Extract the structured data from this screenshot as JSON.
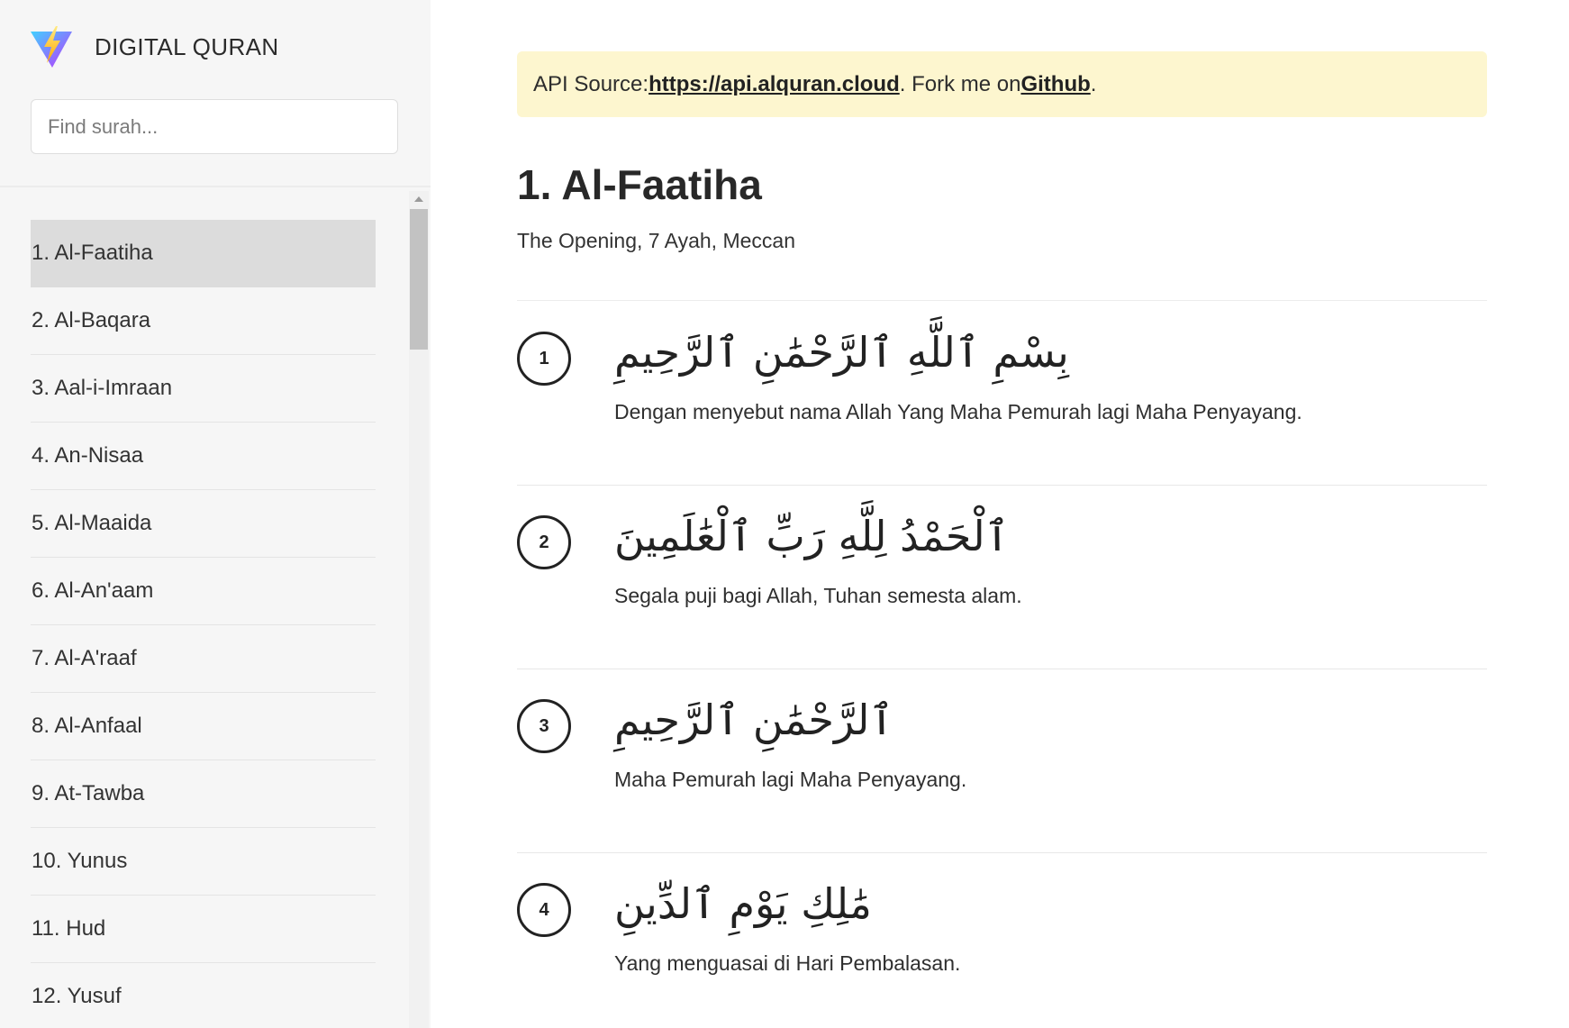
{
  "app": {
    "title": "DIGITAL QURAN"
  },
  "search": {
    "placeholder": "Find surah..."
  },
  "sidebar": {
    "items": [
      {
        "label": "1. Al-Faatiha",
        "active": true
      },
      {
        "label": "2. Al-Baqara"
      },
      {
        "label": "3. Aal-i-Imraan"
      },
      {
        "label": "4. An-Nisaa"
      },
      {
        "label": "5. Al-Maaida"
      },
      {
        "label": "6. Al-An'aam"
      },
      {
        "label": "7. Al-A'raaf"
      },
      {
        "label": "8. Al-Anfaal"
      },
      {
        "label": "9. At-Tawba"
      },
      {
        "label": "10. Yunus"
      },
      {
        "label": "11. Hud"
      },
      {
        "label": "12. Yusuf"
      }
    ]
  },
  "notice": {
    "prefix": "API Source: ",
    "api_link": "https://api.alquran.cloud",
    "middle": ". Fork me on ",
    "github_link": "Github",
    "suffix": "."
  },
  "surah": {
    "title": "1. Al-Faatiha",
    "meta": "The Opening, 7 Ayah, Meccan"
  },
  "ayahs": [
    {
      "number": "1",
      "arabic": "بِسْمِ ٱللَّهِ ٱلرَّحْمَٰنِ ٱلرَّحِيمِ",
      "translation": "Dengan menyebut nama Allah Yang Maha Pemurah lagi Maha Penyayang."
    },
    {
      "number": "2",
      "arabic": "ٱلْحَمْدُ لِلَّهِ رَبِّ ٱلْعَٰلَمِينَ",
      "translation": "Segala puji bagi Allah, Tuhan semesta alam."
    },
    {
      "number": "3",
      "arabic": "ٱلرَّحْمَٰنِ ٱلرَّحِيمِ",
      "translation": "Maha Pemurah lagi Maha Penyayang."
    },
    {
      "number": "4",
      "arabic": "مَٰلِكِ يَوْمِ ٱلدِّينِ",
      "translation": "Yang menguasai di Hari Pembalasan."
    }
  ],
  "colors": {
    "notice_bg": "#fdf6cf",
    "sidebar_bg": "#f6f6f6",
    "active_item_bg": "#dcdcdc"
  }
}
